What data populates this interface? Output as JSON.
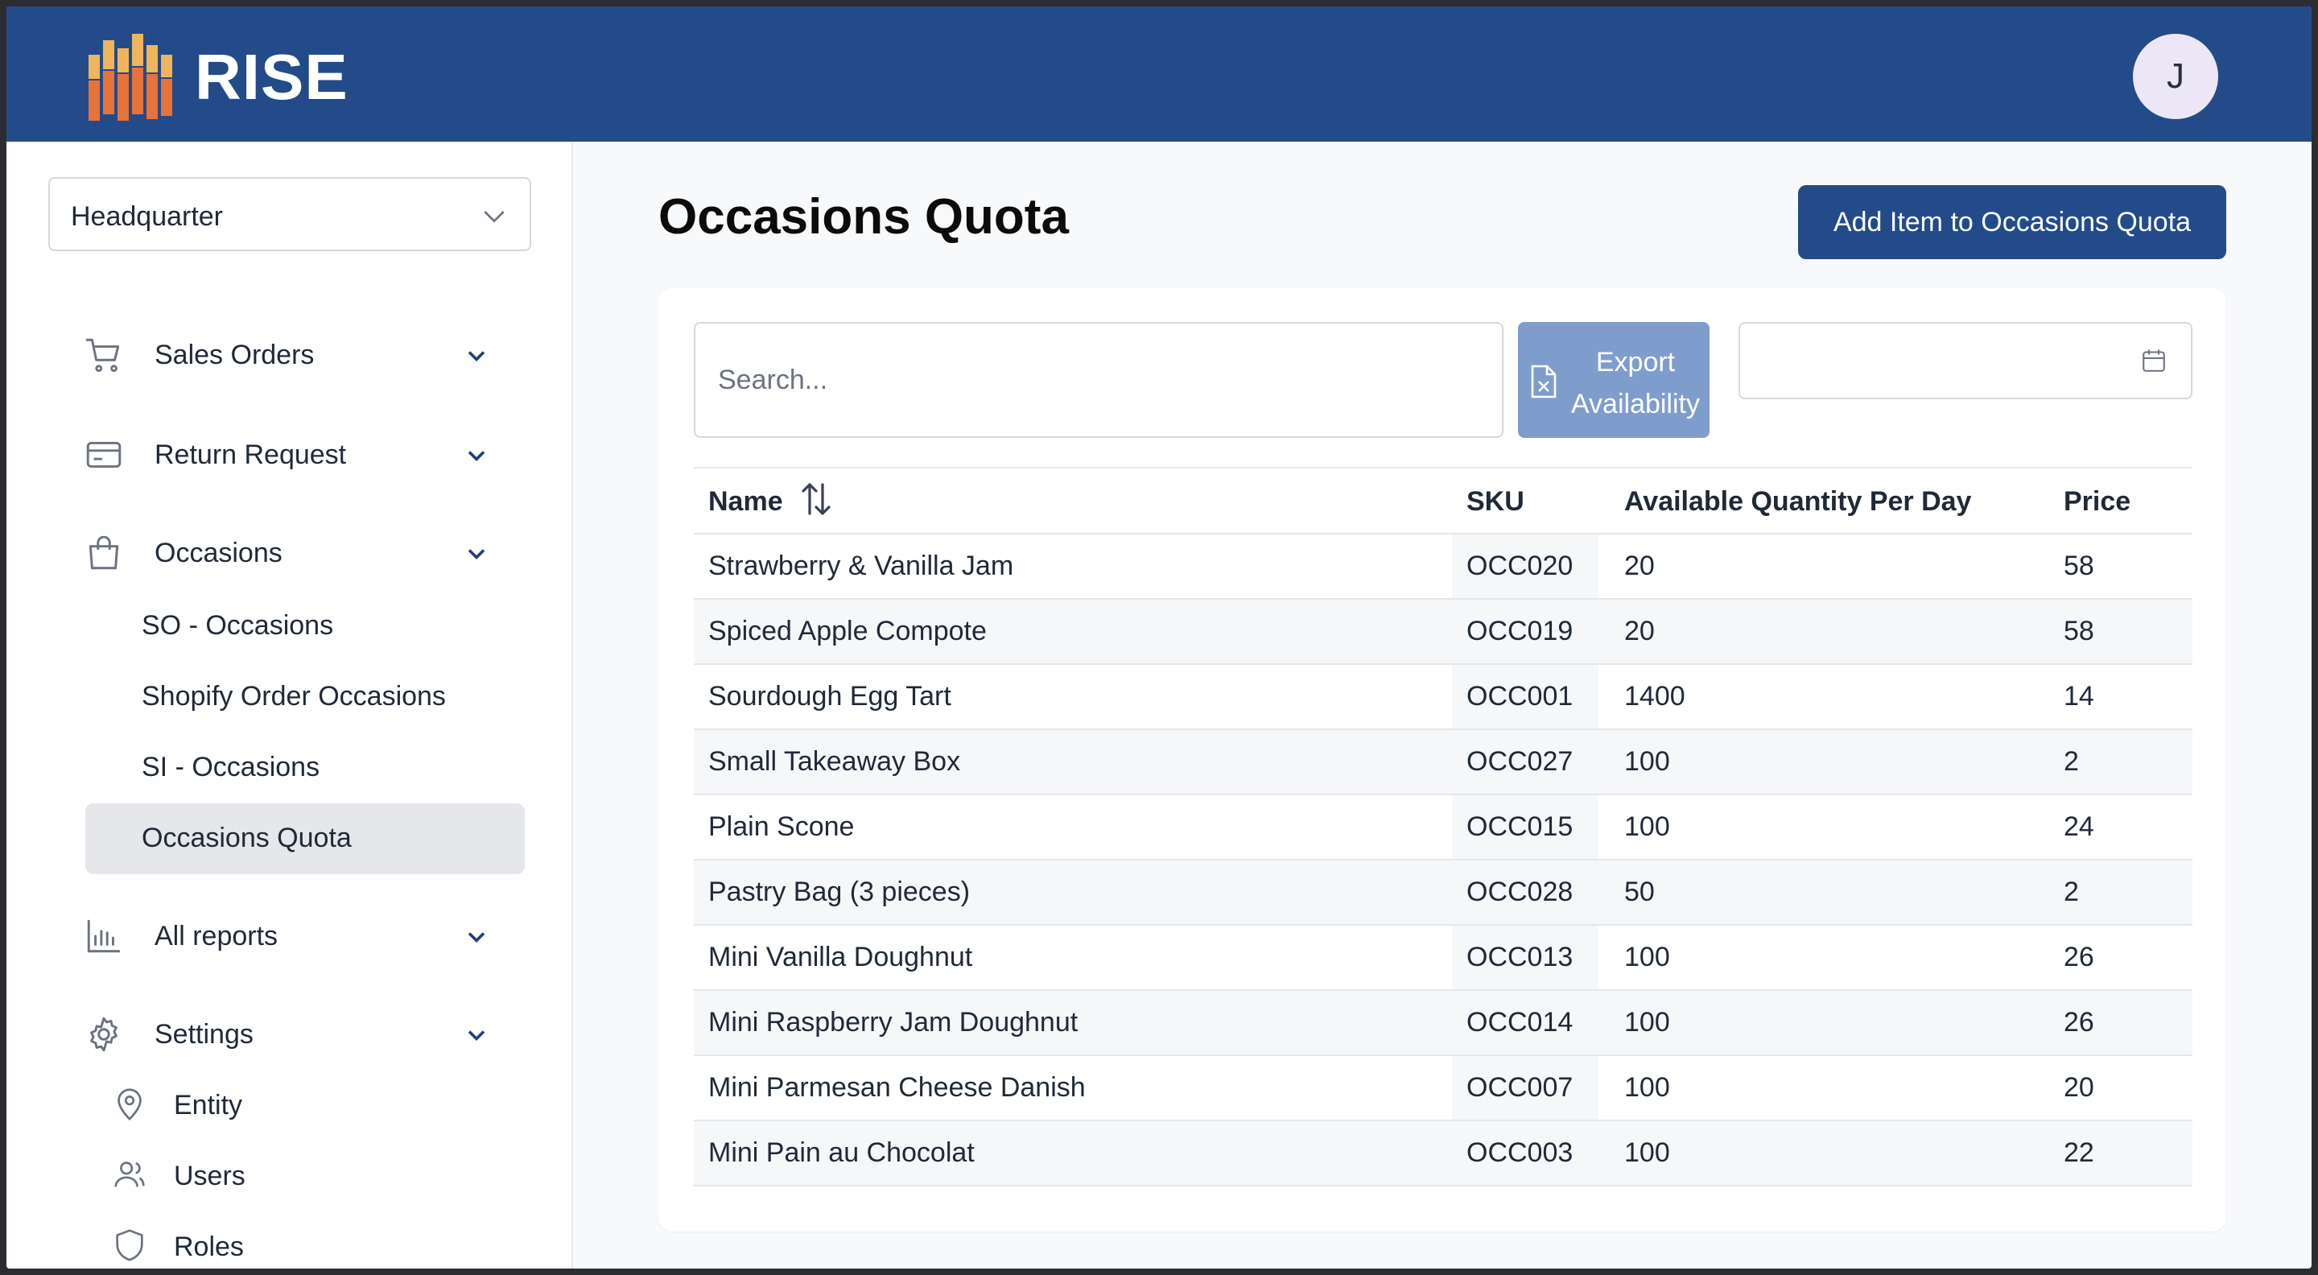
{
  "app": {
    "brand": "RISE",
    "avatar_initial": "J",
    "colors": {
      "header": "#234b8a",
      "accent": "#234b8a",
      "export_button": "#7f9dcc",
      "active_nav": "#e6e7ea"
    }
  },
  "sidebar": {
    "branch_select": "Headquarter",
    "nav": [
      {
        "label": "Sales Orders",
        "icon": "cart-icon"
      },
      {
        "label": "Return Request",
        "icon": "card-icon"
      },
      {
        "label": "Occasions",
        "icon": "bag-icon"
      },
      {
        "label": "All reports",
        "icon": "bar-chart-icon"
      },
      {
        "label": "Settings",
        "icon": "gear-icon"
      }
    ],
    "occasions_sub": [
      {
        "label": "SO - Occasions"
      },
      {
        "label": "Shopify Order Occasions"
      },
      {
        "label": "SI - Occasions"
      },
      {
        "label": "Occasions Quota",
        "active": true
      }
    ],
    "settings_sub": [
      {
        "label": "Entity",
        "icon": "map-pin-icon"
      },
      {
        "label": "Users",
        "icon": "users-icon"
      },
      {
        "label": "Roles",
        "icon": "shield-icon"
      }
    ]
  },
  "main": {
    "title": "Occasions Quota",
    "add_button": "Add Item to Occasions Quota",
    "search_placeholder": "Search...",
    "export_button": "Export Availability",
    "date_value": ""
  },
  "table": {
    "columns": [
      "Name",
      "SKU",
      "Available Quantity Per Day",
      "Price"
    ],
    "rows": [
      {
        "name": "Strawberry & Vanilla Jam",
        "sku": "OCC020",
        "qty": "20",
        "price": "58"
      },
      {
        "name": "Spiced Apple Compote",
        "sku": "OCC019",
        "qty": "20",
        "price": "58"
      },
      {
        "name": "Sourdough Egg Tart",
        "sku": "OCC001",
        "qty": "1400",
        "price": "14"
      },
      {
        "name": "Small Takeaway Box",
        "sku": "OCC027",
        "qty": "100",
        "price": "2"
      },
      {
        "name": "Plain Scone",
        "sku": "OCC015",
        "qty": "100",
        "price": "24"
      },
      {
        "name": "Pastry Bag (3 pieces)",
        "sku": "OCC028",
        "qty": "50",
        "price": "2"
      },
      {
        "name": "Mini Vanilla Doughnut",
        "sku": "OCC013",
        "qty": "100",
        "price": "26"
      },
      {
        "name": "Mini Raspberry Jam Doughnut",
        "sku": "OCC014",
        "qty": "100",
        "price": "26"
      },
      {
        "name": "Mini Parmesan Cheese Danish",
        "sku": "OCC007",
        "qty": "100",
        "price": "20"
      },
      {
        "name": "Mini Pain au Chocolat",
        "sku": "OCC003",
        "qty": "100",
        "price": "22"
      }
    ]
  }
}
